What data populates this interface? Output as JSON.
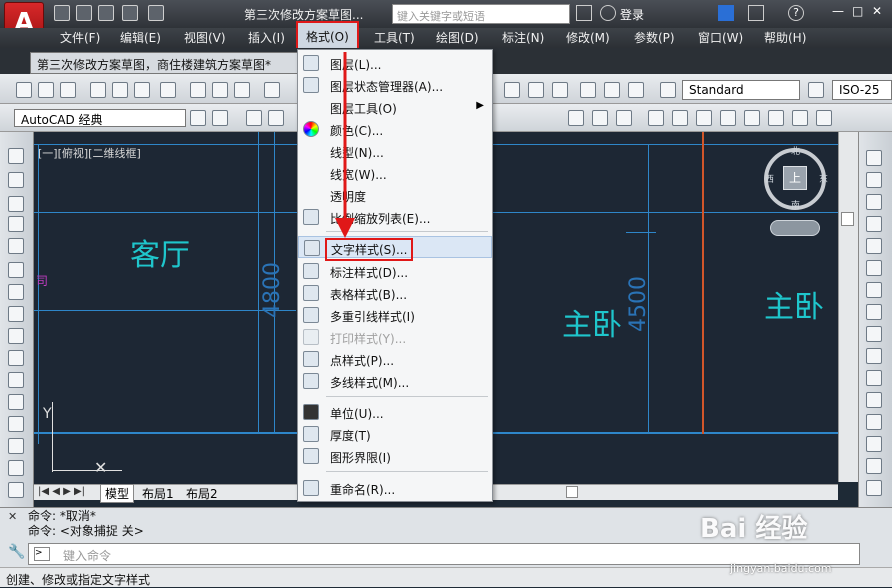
{
  "app": {
    "logo_letter": "A",
    "doc_title": "第三次修改方案草图...",
    "search_placeholder": "键入关键字或短语",
    "login": "登录"
  },
  "menubar": [
    "文件(F)",
    "编辑(E)",
    "视图(V)",
    "插入(I)",
    "格式(O)",
    "工具(T)",
    "绘图(D)",
    "标注(N)",
    "修改(M)",
    "参数(P)",
    "窗口(W)",
    "帮助(H)"
  ],
  "doc_tab": "第三次修改方案草图，商住楼建筑方案草图*",
  "toolbar": {
    "text_style": "Standard",
    "dim_style": "ISO-25",
    "workspace": "AutoCAD 经典"
  },
  "viewport": {
    "view_label": "[一][俯视][二维线框]",
    "rooms": [
      "客厅",
      "主卧",
      "主卧"
    ],
    "dims": [
      "4800",
      "4500"
    ],
    "viewcube": {
      "top": "上",
      "north": "北",
      "south": "南",
      "west": "西",
      "east": "东"
    },
    "axis_y": "Y"
  },
  "layout_tabs": [
    "模型",
    "布局1",
    "布局2"
  ],
  "format_menu": {
    "items": [
      {
        "label": "图层(L)...",
        "icon": "layer-icon"
      },
      {
        "label": "图层状态管理器(A)...",
        "icon": "layer-state-icon"
      },
      {
        "label": "图层工具(O)",
        "icon": "",
        "submenu": true
      },
      {
        "label": "颜色(C)...",
        "icon": "color-wheel-icon"
      },
      {
        "label": "线型(N)...",
        "icon": ""
      },
      {
        "label": "线宽(W)...",
        "icon": ""
      },
      {
        "label": "透明度",
        "icon": ""
      },
      {
        "label": "比例缩放列表(E)...",
        "icon": "scale-list-icon"
      },
      {
        "label": "文字样式(S)...",
        "icon": "text-style-icon",
        "highlighted": true
      },
      {
        "label": "标注样式(D)...",
        "icon": "dim-style-icon"
      },
      {
        "label": "表格样式(B)...",
        "icon": "table-style-icon"
      },
      {
        "label": "多重引线样式(I)",
        "icon": "mleader-style-icon"
      },
      {
        "label": "打印样式(Y)...",
        "icon": "plot-style-icon",
        "disabled": true
      },
      {
        "label": "点样式(P)...",
        "icon": "point-style-icon"
      },
      {
        "label": "多线样式(M)...",
        "icon": "mline-style-icon"
      },
      {
        "label": "单位(U)...",
        "icon": "units-icon"
      },
      {
        "label": "厚度(T)",
        "icon": "thickness-icon"
      },
      {
        "label": "图形界限(I)",
        "icon": "limits-icon"
      },
      {
        "label": "重命名(R)...",
        "icon": "rename-icon"
      }
    ]
  },
  "command": {
    "history": [
      "命令: *取消*",
      "命令:  <对象捕捉 关>"
    ],
    "placeholder": "键入命令"
  },
  "status": "创建、修改或指定文字样式",
  "watermark": {
    "text": "Bai 经验",
    "url": "jingyan.baidu.com"
  }
}
